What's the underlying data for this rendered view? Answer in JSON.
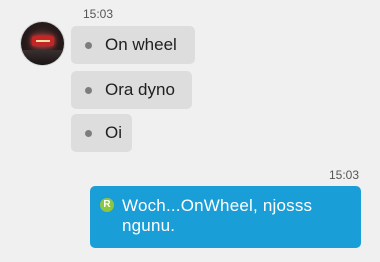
{
  "incoming": {
    "timestamp": "15:03",
    "messages": [
      {
        "text": "On wheel"
      },
      {
        "text": "Ora dyno"
      },
      {
        "text": "Oi"
      }
    ]
  },
  "outgoing": {
    "timestamp": "15:03",
    "status_icon": "R",
    "text": "Woch...OnWheel, njosss ngunu."
  },
  "colors": {
    "background": "#f0f0f0",
    "incoming_bubble": "#dddddd",
    "outgoing_bubble": "#1a9ed8",
    "status_icon": "#8dc63f"
  }
}
